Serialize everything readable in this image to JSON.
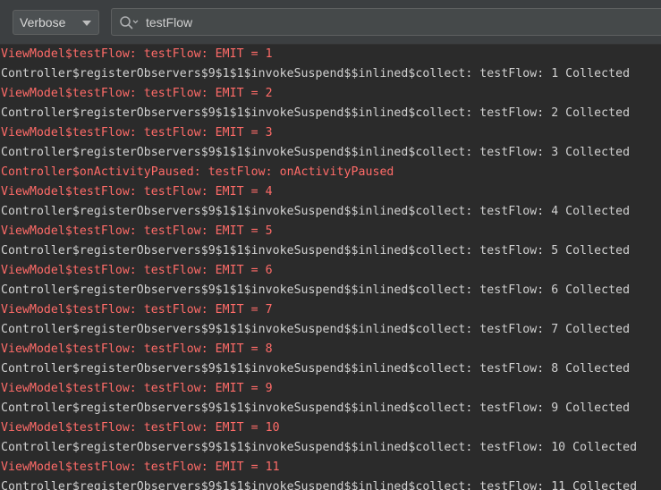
{
  "toolbar": {
    "log_level": "Verbose",
    "search_value": "testFlow",
    "search_icon": "search-icon"
  },
  "colors": {
    "error": "#ff6b68",
    "debug": "#d1d1d1",
    "background": "#2b2b2b",
    "toolbar": "#3c3f41"
  },
  "log": {
    "lines": [
      {
        "level": "error",
        "text": "ViewModel$testFlow: testFlow: EMIT = 1"
      },
      {
        "level": "debug",
        "text": "Controller$registerObservers$9$1$1$invokeSuspend$$inlined$collect: testFlow: 1 Collected"
      },
      {
        "level": "error",
        "text": "ViewModel$testFlow: testFlow: EMIT = 2"
      },
      {
        "level": "debug",
        "text": "Controller$registerObservers$9$1$1$invokeSuspend$$inlined$collect: testFlow: 2 Collected"
      },
      {
        "level": "error",
        "text": "ViewModel$testFlow: testFlow: EMIT = 3"
      },
      {
        "level": "debug",
        "text": "Controller$registerObservers$9$1$1$invokeSuspend$$inlined$collect: testFlow: 3 Collected"
      },
      {
        "level": "error",
        "text": "Controller$onActivityPaused: testFlow: onActivityPaused"
      },
      {
        "level": "error",
        "text": "ViewModel$testFlow: testFlow: EMIT = 4"
      },
      {
        "level": "debug",
        "text": "Controller$registerObservers$9$1$1$invokeSuspend$$inlined$collect: testFlow: 4 Collected"
      },
      {
        "level": "error",
        "text": "ViewModel$testFlow: testFlow: EMIT = 5"
      },
      {
        "level": "debug",
        "text": "Controller$registerObservers$9$1$1$invokeSuspend$$inlined$collect: testFlow: 5 Collected"
      },
      {
        "level": "error",
        "text": "ViewModel$testFlow: testFlow: EMIT = 6"
      },
      {
        "level": "debug",
        "text": "Controller$registerObservers$9$1$1$invokeSuspend$$inlined$collect: testFlow: 6 Collected"
      },
      {
        "level": "error",
        "text": "ViewModel$testFlow: testFlow: EMIT = 7"
      },
      {
        "level": "debug",
        "text": "Controller$registerObservers$9$1$1$invokeSuspend$$inlined$collect: testFlow: 7 Collected"
      },
      {
        "level": "error",
        "text": "ViewModel$testFlow: testFlow: EMIT = 8"
      },
      {
        "level": "debug",
        "text": "Controller$registerObservers$9$1$1$invokeSuspend$$inlined$collect: testFlow: 8 Collected"
      },
      {
        "level": "error",
        "text": "ViewModel$testFlow: testFlow: EMIT = 9"
      },
      {
        "level": "debug",
        "text": "Controller$registerObservers$9$1$1$invokeSuspend$$inlined$collect: testFlow: 9 Collected"
      },
      {
        "level": "error",
        "text": "ViewModel$testFlow: testFlow: EMIT = 10"
      },
      {
        "level": "debug",
        "text": "Controller$registerObservers$9$1$1$invokeSuspend$$inlined$collect: testFlow: 10 Collected"
      },
      {
        "level": "error",
        "text": "ViewModel$testFlow: testFlow: EMIT = 11"
      },
      {
        "level": "debug",
        "text": "Controller$registerObservers$9$1$1$invokeSuspend$$inlined$collect: testFlow: 11 Collected"
      }
    ]
  }
}
